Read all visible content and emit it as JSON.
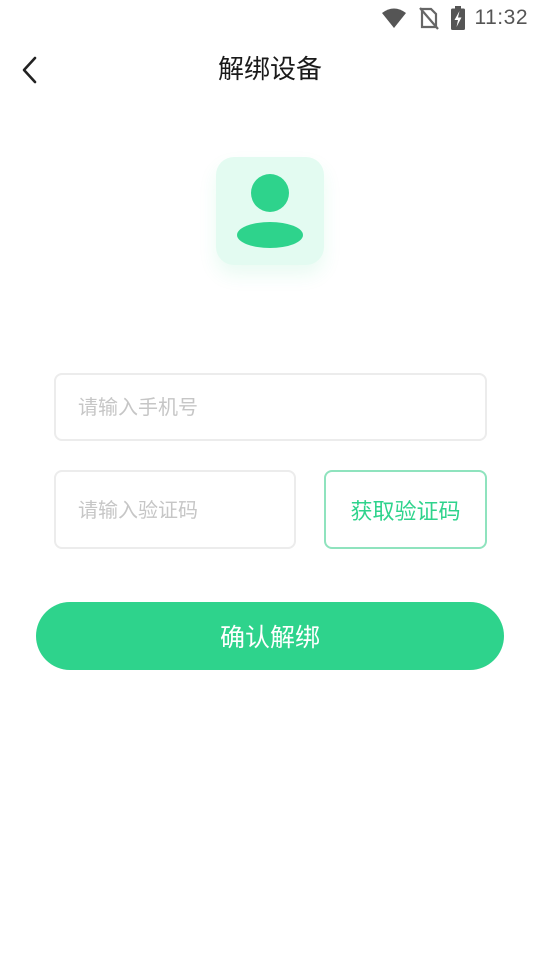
{
  "status_bar": {
    "time": "11:32",
    "icons": [
      "wifi-icon",
      "no-sim-icon",
      "battery-charging-icon"
    ]
  },
  "nav": {
    "back_icon": "chevron-left-icon",
    "title": "解绑设备"
  },
  "avatar": {
    "icon": "user-avatar-icon",
    "accent_color": "#2ed38c",
    "background_color": "#e3fbf1"
  },
  "form": {
    "phone": {
      "placeholder": "请输入手机号",
      "value": ""
    },
    "code": {
      "placeholder": "请输入验证码",
      "value": ""
    },
    "get_code_label": "获取验证码",
    "confirm_label": "确认解绑"
  },
  "colors": {
    "primary": "#2ed38c",
    "input_border": "#ececec",
    "placeholder": "#c6c6c6"
  }
}
